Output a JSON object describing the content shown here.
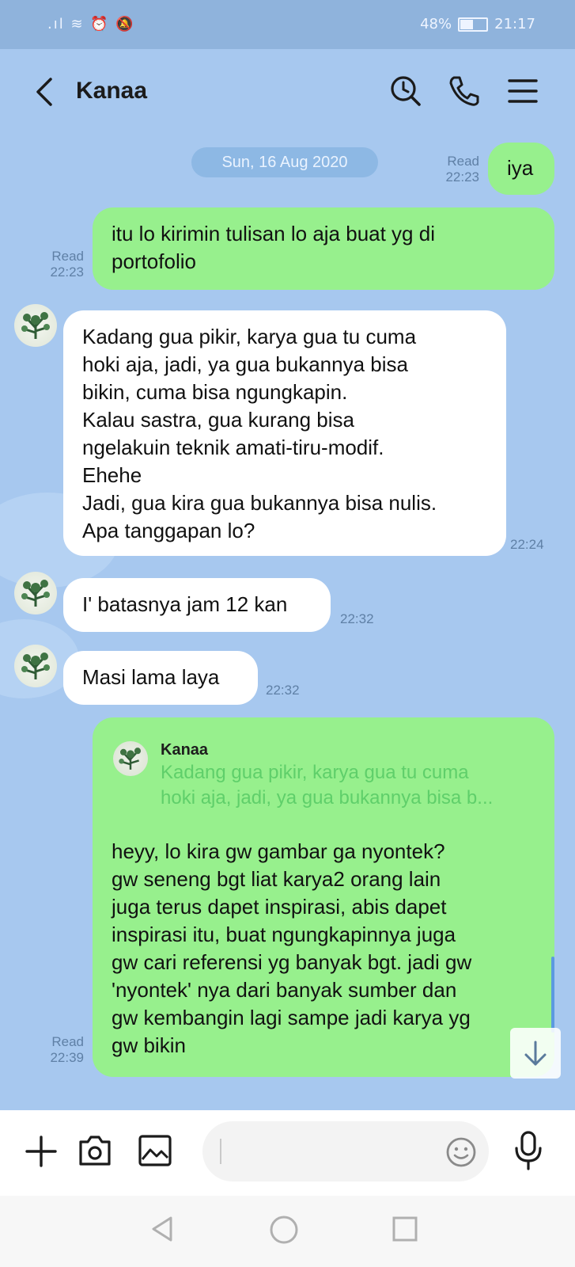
{
  "status_bar": {
    "signal_icons": ".ıl ≋ ⏰ 🔕",
    "battery_percent": "48%",
    "battery_level": 0.48,
    "time": "21:17"
  },
  "header": {
    "contact_name": "Kanaa",
    "icons": [
      "back-chevron-icon",
      "search-history-icon",
      "phone-icon",
      "menu-icon"
    ]
  },
  "date_divider": "Sun, 16 Aug 2020",
  "messages": [
    {
      "side": "out",
      "text": "iya",
      "status": "Read",
      "time": "22:23"
    },
    {
      "side": "out",
      "text": "itu lo kirimin tulisan lo aja buat yg di\nportofolio",
      "status": "Read",
      "time": "22:23"
    },
    {
      "side": "in",
      "text": "Kadang gua pikir, karya gua tu cuma\nhoki aja, jadi, ya gua bukannya bisa\nbikin, cuma bisa ngungkapin.\nKalau sastra, gua kurang bisa\nngelakuin teknik amati-tiru-modif.\nEhehe\nJadi, gua kira gua bukannya bisa nulis.\nApa tanggapan lo?",
      "time": "22:24"
    },
    {
      "side": "in",
      "text": "I' batasnya jam 12 kan",
      "time": "22:32"
    },
    {
      "side": "in",
      "text": "Masi lama laya",
      "time": "22:32"
    },
    {
      "side": "out",
      "reply_to": {
        "name": "Kanaa",
        "line1": "Kadang gua pikir, karya gua tu cuma",
        "line2": "hoki aja, jadi, ya gua bukannya bisa b..."
      },
      "text": "heyy, lo kira gw gambar ga nyontek?\ngw seneng bgt liat karya2 orang lain\njuga terus dapet inspirasi, abis dapet\ninspirasi itu, buat ngungkapinnya juga\ngw cari referensi yg banyak bgt. jadi gw\n'nyontek' nya dari banyak sumber dan\ngw kembangin lagi sampe jadi karya yg\ngw bikin",
      "status": "Read",
      "time": "22:39"
    }
  ],
  "composer": {
    "input_value": "",
    "icons": [
      "plus-icon",
      "camera-icon",
      "image-icon",
      "emoji-icon",
      "microphone-icon"
    ]
  },
  "nav_bar": {
    "icons": [
      "back-triangle-icon",
      "home-circle-icon",
      "recents-square-icon"
    ]
  },
  "colors": {
    "chat_background": "#a7c8ef",
    "outgoing_bubble": "#97f08d",
    "incoming_bubble": "#ffffff",
    "status_bar": "#8fb3dc",
    "reply_quote_text": "#5fcf6a"
  }
}
